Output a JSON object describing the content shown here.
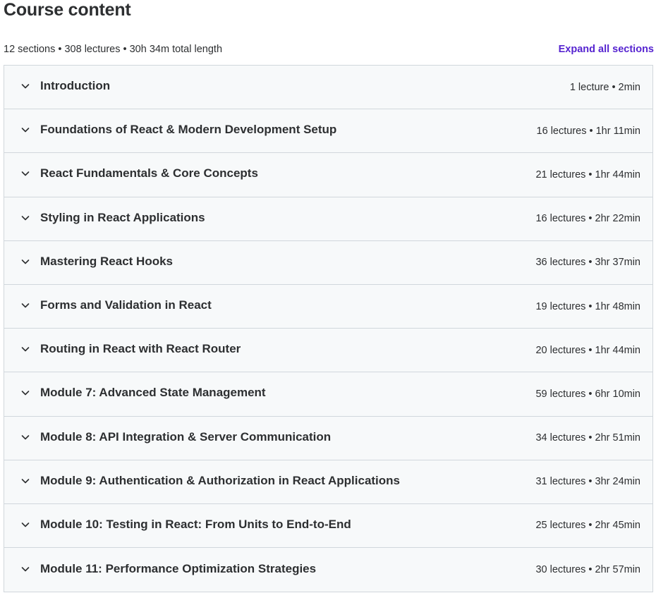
{
  "header": {
    "title": "Course content",
    "summary": "12 sections • 308 lectures • 30h 34m total length",
    "expand_all_label": "Expand all sections"
  },
  "colors": {
    "accent": "#5624d0",
    "row_background": "#f7f9fa",
    "border": "#d1d7dc",
    "text": "#2d2f31"
  },
  "icons": {
    "section_toggle": "chevron-down-icon"
  },
  "sections": [
    {
      "title": "Introduction",
      "meta": "1 lecture • 2min"
    },
    {
      "title": "Foundations of React & Modern Development Setup",
      "meta": "16 lectures • 1hr 11min"
    },
    {
      "title": "React Fundamentals & Core Concepts",
      "meta": "21 lectures • 1hr 44min"
    },
    {
      "title": "Styling in React Applications",
      "meta": "16 lectures • 2hr 22min"
    },
    {
      "title": "Mastering React Hooks",
      "meta": "36 lectures • 3hr 37min"
    },
    {
      "title": "Forms and Validation in React",
      "meta": "19 lectures • 1hr 48min"
    },
    {
      "title": "Routing in React with React Router",
      "meta": "20 lectures • 1hr 44min"
    },
    {
      "title": "Module 7: Advanced State Management",
      "meta": "59 lectures • 6hr 10min"
    },
    {
      "title": "Module 8: API Integration & Server Communication",
      "meta": "34 lectures • 2hr 51min"
    },
    {
      "title": "Module 9: Authentication & Authorization in React Applications",
      "meta": "31 lectures • 3hr 24min"
    },
    {
      "title": "Module 10: Testing in React: From Units to End-to-End",
      "meta": "25 lectures • 2hr 45min"
    },
    {
      "title": "Module 11: Performance Optimization Strategies",
      "meta": "30 lectures • 2hr 57min"
    }
  ]
}
